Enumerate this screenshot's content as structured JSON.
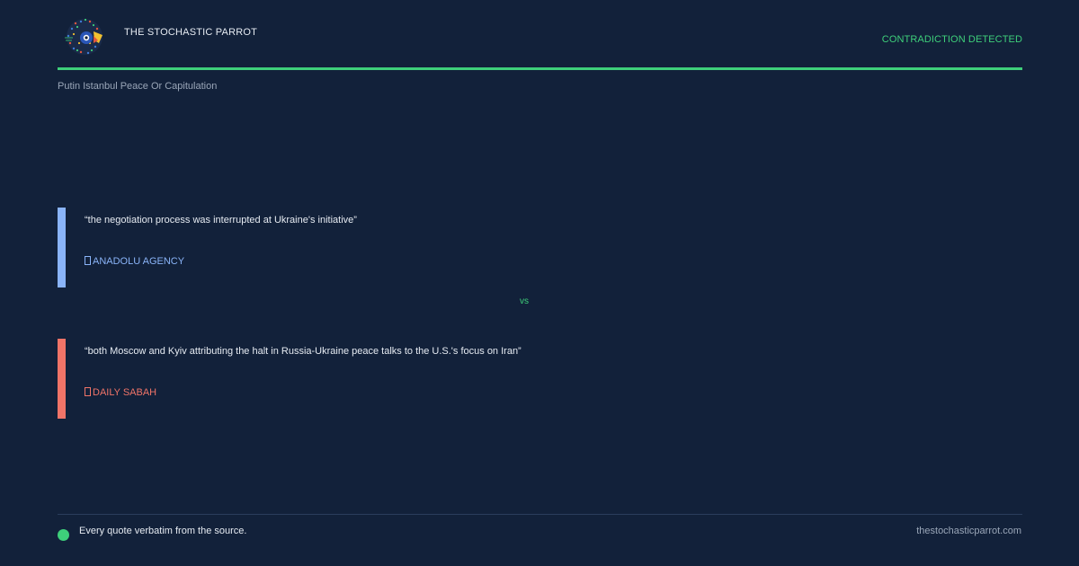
{
  "header": {
    "brand": "THE STOCHASTIC PARROT",
    "status": "CONTRADICTION DETECTED",
    "logo_icon": "parrot-icon"
  },
  "topic": "Putin Istanbul Peace Or Capitulation",
  "claims": [
    {
      "quote": "“the negotiation process was interrupted at Ukraine's initiative”",
      "source": "ANADOLU AGENCY",
      "color": "#8ab4f8"
    },
    {
      "quote": "“both Moscow and Kyiv attributing the halt in Russia-Ukraine peace talks to the U.S.'s focus on Iran”",
      "source": "DAILY SABAH",
      "color": "#f07468"
    }
  ],
  "vs": "vs",
  "footer": {
    "note": "Every quote verbatim from the source.",
    "site": "thestochasticparrot.com"
  },
  "colors": {
    "background": "#12213a",
    "accent": "#3ecf7a"
  }
}
